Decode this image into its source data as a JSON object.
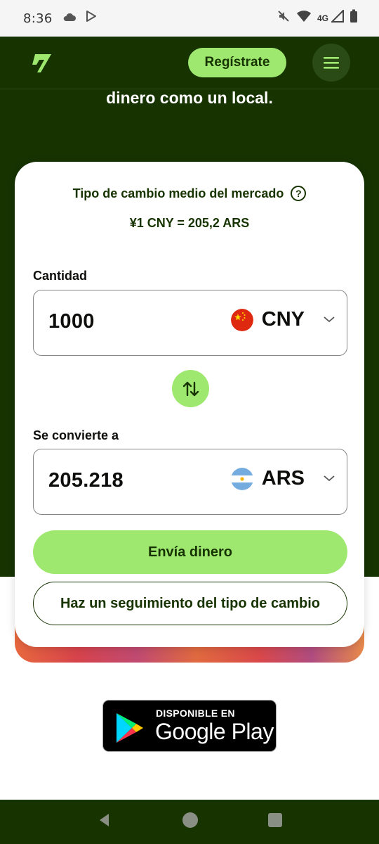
{
  "status_bar": {
    "time": "8:36",
    "network": "4G",
    "icons": [
      "cloud-icon",
      "play-store-icon",
      "mute-icon",
      "wifi-icon",
      "signal-icon",
      "battery-icon"
    ]
  },
  "nav": {
    "register_label": "Regístrate",
    "menu_icon": "hamburger-menu-icon"
  },
  "hero": {
    "title": "dinero como un local."
  },
  "converter": {
    "rate_title": "Tipo de cambio medio del mercado",
    "rate_value": "¥1 CNY = 205,2 ARS",
    "amount_label": "Cantidad",
    "amount_value": "1000",
    "from_currency": "CNY",
    "converted_label": "Se convierte a",
    "converted_value": "205.218",
    "to_currency": "ARS",
    "send_label": "Envía dinero",
    "track_label": "Haz un seguimiento del tipo de cambio"
  },
  "store_badge": {
    "small_text": "DISPONIBLE EN",
    "big_text": "Google Play"
  },
  "colors": {
    "brand_dark": "#163300",
    "brand_green": "#9fe870"
  }
}
